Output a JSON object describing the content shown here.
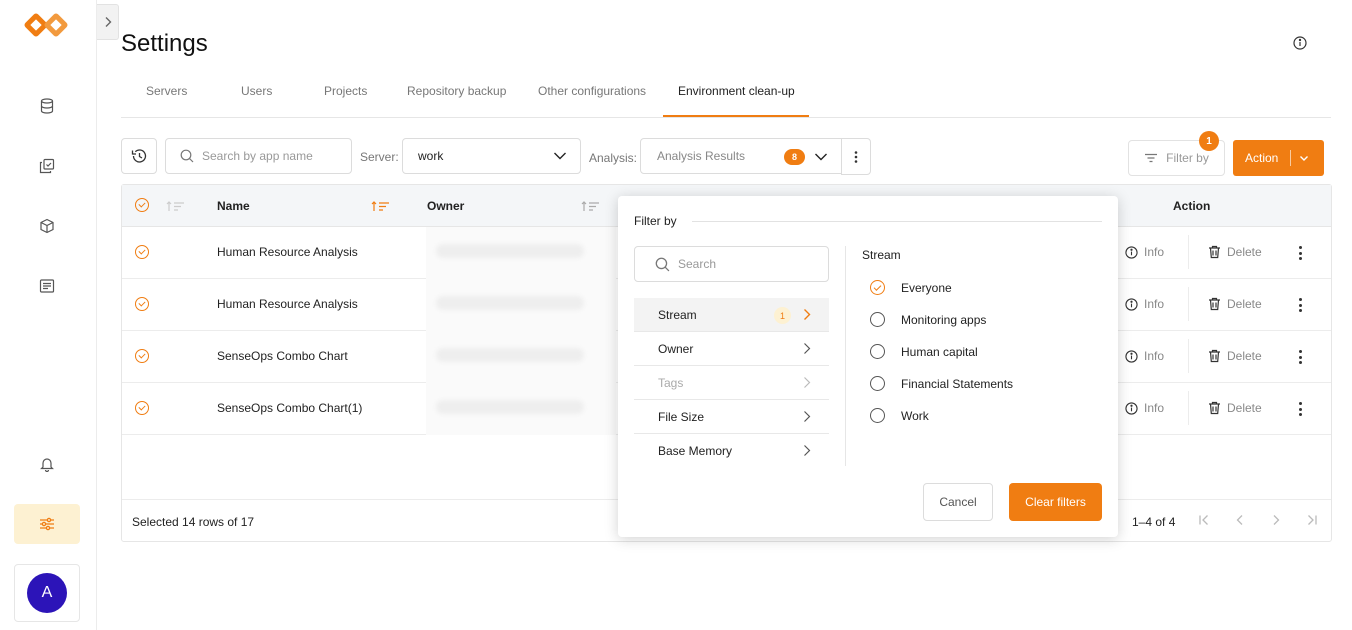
{
  "app": {
    "title": "Settings",
    "avatar_initial": "A",
    "accent": "#f07d12"
  },
  "rail": {
    "icons": [
      "database-icon",
      "apps-icon",
      "package-icon",
      "report-icon",
      "bell-icon",
      "settings-sliders-icon"
    ]
  },
  "tabs": [
    {
      "label": "Servers"
    },
    {
      "label": "Users"
    },
    {
      "label": "Projects"
    },
    {
      "label": "Repository backup"
    },
    {
      "label": "Other configurations"
    },
    {
      "label": "Environment clean-up"
    }
  ],
  "toolbar": {
    "search_placeholder": "Search by app name",
    "server_label": "Server:",
    "server_value": "work",
    "analysis_label": "Analysis:",
    "analysis_value": "Analysis Results",
    "analysis_count": "8",
    "filter_label": "Filter by",
    "filter_count": "1",
    "action_label": "Action"
  },
  "table": {
    "columns": {
      "name": "Name",
      "owner": "Owner",
      "action": "Action"
    },
    "rows": [
      {
        "name": "Human Resource Analysis"
      },
      {
        "name": "Human Resource Analysis"
      },
      {
        "name": "SenseOps Combo Chart"
      },
      {
        "name": "SenseOps Combo Chart(1)"
      }
    ],
    "info_label": "Info",
    "delete_label": "Delete",
    "footer_selected": "Selected 14 rows of 17",
    "pagination": "1–4 of 4"
  },
  "filter_popover": {
    "title": "Filter by",
    "search_placeholder": "Search",
    "categories": [
      {
        "label": "Stream",
        "count": "1"
      },
      {
        "label": "Owner"
      },
      {
        "label": "Tags"
      },
      {
        "label": "File Size"
      },
      {
        "label": "Base Memory"
      }
    ],
    "stream_title": "Stream",
    "options": [
      {
        "label": "Everyone"
      },
      {
        "label": "Monitoring apps"
      },
      {
        "label": "Human capital"
      },
      {
        "label": "Financial Statements"
      },
      {
        "label": "Work"
      }
    ],
    "cancel_label": "Cancel",
    "clear_label": "Clear filters"
  }
}
